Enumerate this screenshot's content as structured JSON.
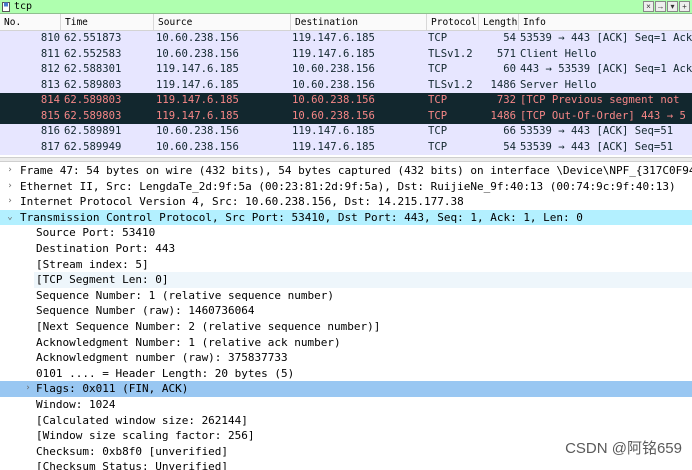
{
  "filter": {
    "value": "tcp",
    "clear_label": "×",
    "arrow_label": "→",
    "dropdown_label": "▾",
    "plus_label": "+"
  },
  "columns": [
    "No.",
    "Time",
    "Source",
    "Destination",
    "Protocol",
    "Length",
    "Info"
  ],
  "packets": [
    {
      "no": "810",
      "time": "62.551873",
      "src": "10.60.238.156",
      "dst": "119.147.6.185",
      "proto": "TCP",
      "len": "54",
      "info": "53539 → 443 [ACK] Seq=1 Ack=",
      "style": "tcp"
    },
    {
      "no": "811",
      "time": "62.552583",
      "src": "10.60.238.156",
      "dst": "119.147.6.185",
      "proto": "TLSv1.2",
      "len": "571",
      "info": "Client Hello",
      "style": "tcp"
    },
    {
      "no": "812",
      "time": "62.588301",
      "src": "119.147.6.185",
      "dst": "10.60.238.156",
      "proto": "TCP",
      "len": "60",
      "info": "443 → 53539 [ACK] Seq=1 Ack=",
      "style": "tcp"
    },
    {
      "no": "813",
      "time": "62.589803",
      "src": "119.147.6.185",
      "dst": "10.60.238.156",
      "proto": "TLSv1.2",
      "len": "1486",
      "info": "Server Hello",
      "style": "tcp"
    },
    {
      "no": "814",
      "time": "62.589803",
      "src": "119.147.6.185",
      "dst": "10.60.238.156",
      "proto": "TCP",
      "len": "732",
      "info": "[TCP Previous segment not",
      "style": "bad"
    },
    {
      "no": "815",
      "time": "62.589803",
      "src": "119.147.6.185",
      "dst": "10.60.238.156",
      "proto": "TCP",
      "len": "1486",
      "info": "[TCP Out-Of-Order] 443 → 5",
      "style": "bad"
    },
    {
      "no": "816",
      "time": "62.589891",
      "src": "10.60.238.156",
      "dst": "119.147.6.185",
      "proto": "TCP",
      "len": "66",
      "info": "53539 → 443 [ACK] Seq=51",
      "style": "tcp"
    },
    {
      "no": "817",
      "time": "62.589949",
      "src": "10.60.238.156",
      "dst": "119.147.6.185",
      "proto": "TCP",
      "len": "54",
      "info": "53539 → 443 [ACK] Seq=51",
      "style": "tcp"
    }
  ],
  "details": [
    {
      "text": "Frame 47: 54 bytes on wire (432 bits), 54 bytes captured (432 bits) on interface \\Device\\NPF_{317C0F94-",
      "indent": 0,
      "arrow": "›",
      "style": ""
    },
    {
      "text": "Ethernet II, Src: LengdaTe_2d:9f:5a (00:23:81:2d:9f:5a), Dst: RuijieNe_9f:40:13 (00:74:9c:9f:40:13)",
      "indent": 0,
      "arrow": "›",
      "style": ""
    },
    {
      "text": "Internet Protocol Version 4, Src: 10.60.238.156, Dst: 14.215.177.38",
      "indent": 0,
      "arrow": "›",
      "style": ""
    },
    {
      "text": "Transmission Control Protocol, Src Port: 53410, Dst Port: 443, Seq: 1, Ack: 1, Len: 0",
      "indent": 0,
      "arrow": "⌄",
      "style": "sel"
    },
    {
      "text": "Source Port: 53410",
      "indent": 1,
      "arrow": "",
      "style": ""
    },
    {
      "text": "Destination Port: 443",
      "indent": 1,
      "arrow": "",
      "style": ""
    },
    {
      "text": "[Stream index: 5]",
      "indent": 1,
      "arrow": "",
      "style": ""
    },
    {
      "text": "[TCP Segment Len: 0]",
      "indent": 1,
      "arrow": "",
      "style": "gen"
    },
    {
      "text": "Sequence Number: 1    (relative sequence number)",
      "indent": 1,
      "arrow": "",
      "style": ""
    },
    {
      "text": "Sequence Number (raw): 1460736064",
      "indent": 1,
      "arrow": "",
      "style": ""
    },
    {
      "text": "[Next Sequence Number: 2    (relative sequence number)]",
      "indent": 1,
      "arrow": "",
      "style": ""
    },
    {
      "text": "Acknowledgment Number: 1    (relative ack number)",
      "indent": 1,
      "arrow": "",
      "style": ""
    },
    {
      "text": "Acknowledgment number (raw): 375837733",
      "indent": 1,
      "arrow": "",
      "style": ""
    },
    {
      "text": "0101 .... = Header Length: 20 bytes (5)",
      "indent": 1,
      "arrow": "",
      "style": ""
    },
    {
      "text": "Flags: 0x011 (FIN, ACK)",
      "indent": 1,
      "arrow": "›",
      "style": "flag"
    },
    {
      "text": "Window: 1024",
      "indent": 1,
      "arrow": "",
      "style": ""
    },
    {
      "text": "[Calculated window size: 262144]",
      "indent": 1,
      "arrow": "",
      "style": ""
    },
    {
      "text": "[Window size scaling factor: 256]",
      "indent": 1,
      "arrow": "",
      "style": ""
    },
    {
      "text": "Checksum: 0xb8f0 [unverified]",
      "indent": 1,
      "arrow": "",
      "style": ""
    },
    {
      "text": "[Checksum Status: Unverified]",
      "indent": 1,
      "arrow": "",
      "style": ""
    }
  ],
  "watermark": "CSDN @阿铭659"
}
